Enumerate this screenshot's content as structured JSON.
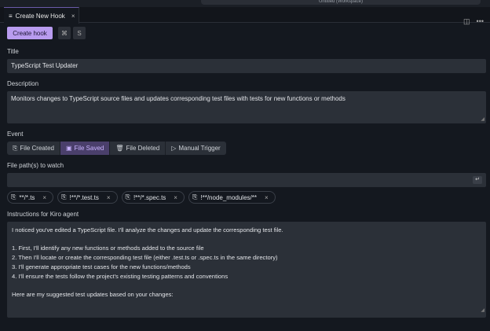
{
  "window": {
    "workspace_title": "Untitled (Workspace)"
  },
  "tab": {
    "icon": "list-icon",
    "label": "Create New Hook",
    "close": "×"
  },
  "toolbar": {
    "create_label": "Create hook",
    "shortcut_keys": [
      "⌘",
      "S"
    ]
  },
  "title": {
    "label": "Title",
    "value": "TypeScript Test Updater"
  },
  "description": {
    "label": "Description",
    "value": "Monitors changes to TypeScript source files and updates corresponding test files with tests for new functions or methods"
  },
  "event": {
    "label": "Event",
    "options": [
      {
        "icon": "file-plus-icon",
        "glyph": "⎘",
        "label": "File Created"
      },
      {
        "icon": "save-icon",
        "glyph": "▣",
        "label": "File Saved",
        "active": true
      },
      {
        "icon": "trash-icon",
        "glyph": "🗑",
        "label": "File Deleted"
      },
      {
        "icon": "play-icon",
        "glyph": "▷",
        "label": "Manual Trigger"
      }
    ]
  },
  "paths": {
    "label": "File path(s) to watch",
    "value": "",
    "enter_icon": "↵",
    "chips": [
      "**/*.ts",
      "!**/*.test.ts",
      "!**/*.spec.ts",
      "!**/node_modules/**"
    ]
  },
  "instructions": {
    "label": "Instructions for Kiro agent",
    "lines": [
      "I noticed you've edited a TypeScript file. I'll analyze the changes and update the corresponding test file.",
      "",
      "1. First, I'll identify any new functions or methods added to the source file",
      "2. Then I'll locate or create the corresponding test file (either .test.ts or .spec.ts in the same directory)",
      "3. I'll generate appropriate test cases for the new functions/methods",
      "4. I'll ensure the tests follow the project's existing testing patterns and conventions",
      "",
      "Here are my suggested test updates based on your changes:"
    ]
  },
  "colors": {
    "accent": "#b99cf0",
    "active_segment": "#4a3f6b"
  }
}
